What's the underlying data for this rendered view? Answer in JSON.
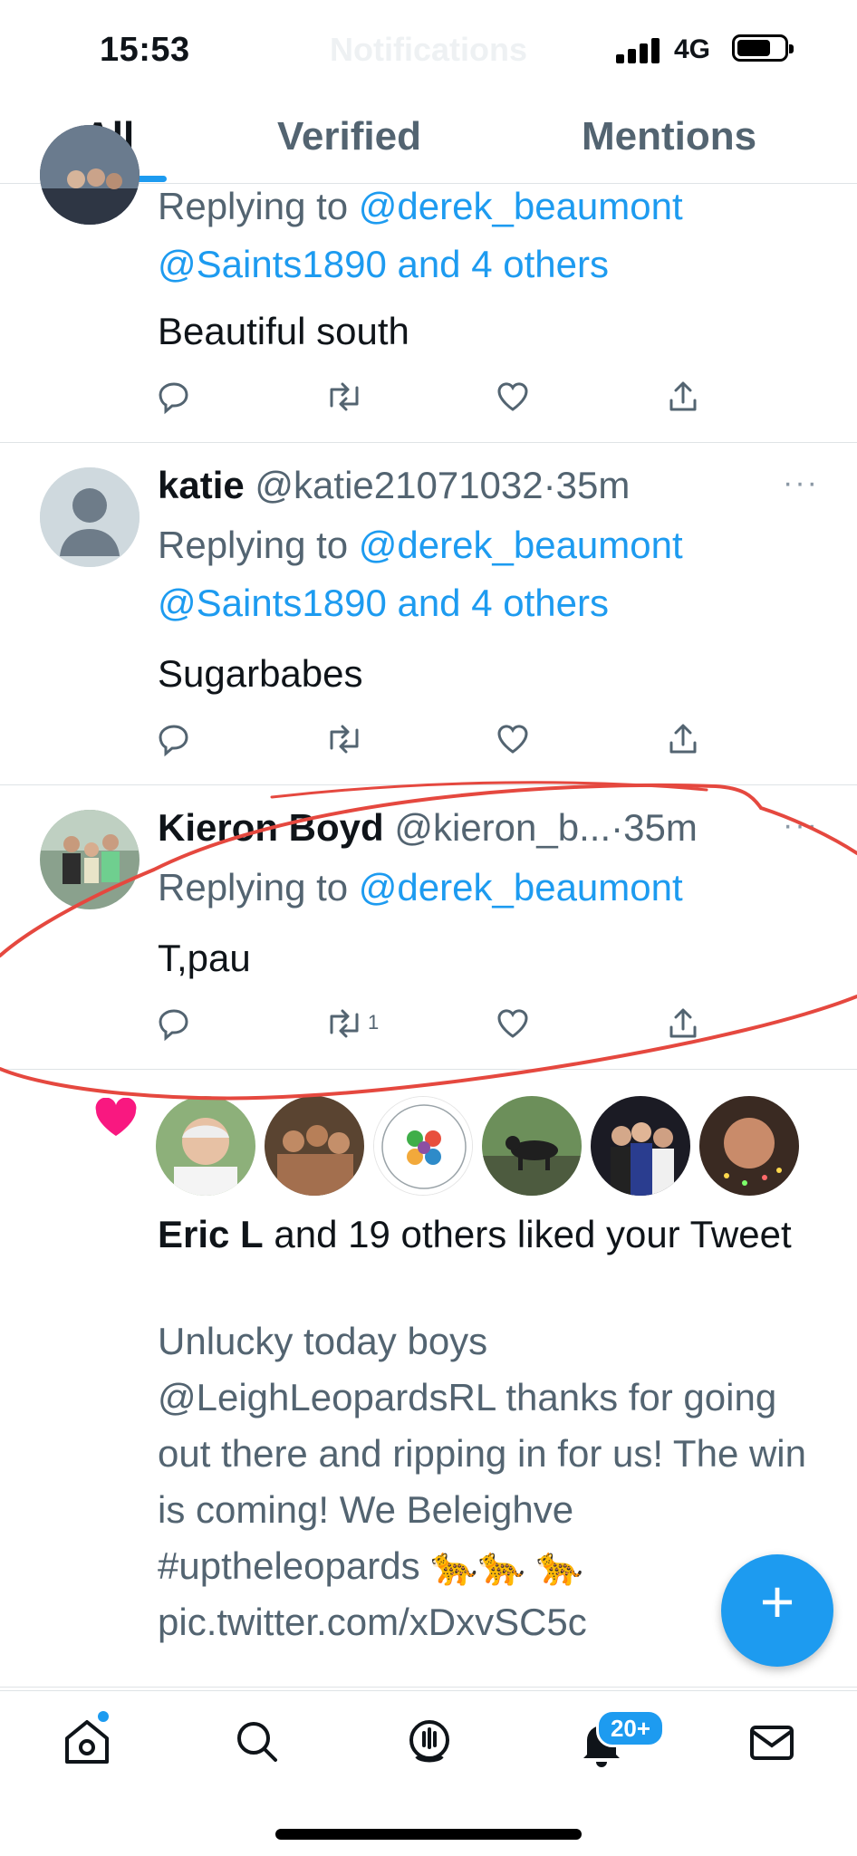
{
  "status_bar": {
    "time": "15:53",
    "network": "4G",
    "ghost_title": "Notifications"
  },
  "tabs": [
    {
      "label": "All",
      "active": true
    },
    {
      "label": "Verified",
      "active": false
    },
    {
      "label": "Mentions",
      "active": false
    }
  ],
  "tweets": [
    {
      "replying_prefix": "Replying to",
      "mention_line1": "@derek_beaumont",
      "mention_line2": "@Saints1890 and 4 others",
      "text": "Beautiful south",
      "retweet_count": ""
    },
    {
      "name": "katie",
      "handle": "@katie21071032",
      "time": "·35m",
      "replying_prefix": "Replying to",
      "mention_line1": "@derek_beaumont",
      "mention_line2": "@Saints1890 and 4 others",
      "text": "Sugarbabes",
      "retweet_count": ""
    },
    {
      "name": "Kieron Boyd",
      "handle": "@kieron_b...",
      "time": "·35m",
      "replying_prefix": "Replying to",
      "mention_line1": "@derek_beaumont",
      "text": "T,pau",
      "retweet_count": "1"
    }
  ],
  "like_notification": {
    "name": "Eric L",
    "rest": " and 19 others liked your Tweet",
    "tweet_text": "Unlucky today boys @LeighLeopardsRL thanks for going out there and ripping in for us! The win is coming! We Beleighve #uptheleopards 🐆🐆 🐆 pic.twitter.com/xDxvSC5c"
  },
  "fab": {
    "label": "+"
  },
  "bottom_nav": {
    "notifications_badge": "20+"
  },
  "colors": {
    "accent": "#1d9bf0",
    "annotation": "#e5483f",
    "like": "#f91880"
  }
}
